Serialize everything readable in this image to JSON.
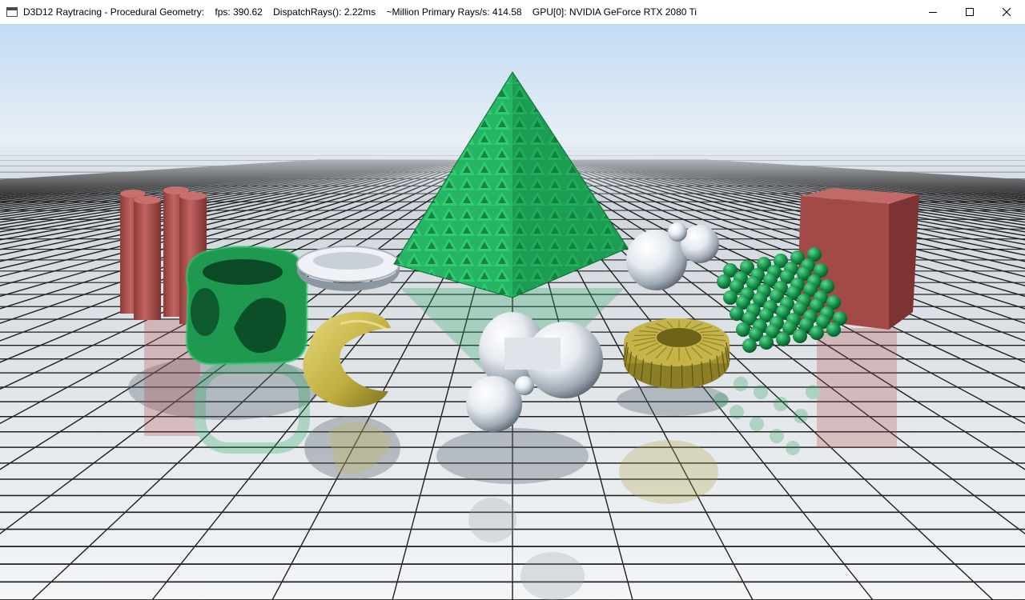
{
  "window": {
    "title": "D3D12 Raytracing - Procedural Geometry:    fps: 390.62    DispatchRays(): 2.22ms    ~Million Primary Rays/s: 414.58    GPU[0]: NVIDIA GeForce RTX 2080 Ti",
    "icons": {
      "app": "app-window-icon",
      "minimize": "minimize-icon",
      "maximize": "maximize-icon",
      "close": "close-icon"
    }
  },
  "scene": {
    "colors": {
      "sky_top": "#c4dcf4",
      "horizon": "#eef3f8",
      "floor_far": "#c9d1da",
      "floor_near": "#f2f4f6",
      "grid_line": "#1a1a1a",
      "green": "#22a05a",
      "red": "#a84a48",
      "gold": "#c9b84a",
      "chrome": "#d8dde4"
    }
  }
}
